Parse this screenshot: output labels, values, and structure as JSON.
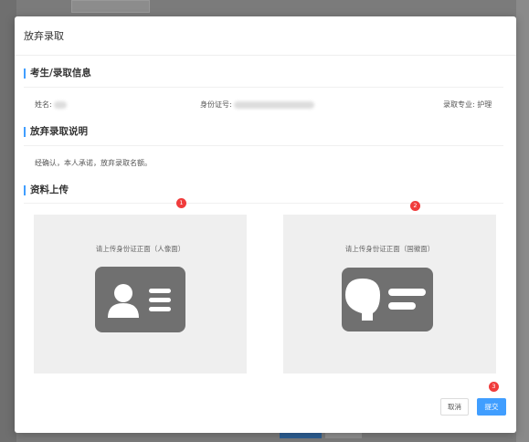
{
  "dialog": {
    "title": "放弃录取"
  },
  "sections": {
    "info_title": "考生/录取信息",
    "desc_title": "放弃录取说明",
    "upload_title": "资料上传"
  },
  "info": {
    "name_label": "姓名:",
    "id_label": "身份证号:",
    "major_label": "录取专业:",
    "major_value": "护理"
  },
  "description": "经确认，本人承诺，放弃录取名额。",
  "uploads": [
    {
      "label": "请上传身份证正面（人像面）",
      "icon": "id-card-portrait-icon"
    },
    {
      "label": "请上传身份证正面（国徽面）",
      "icon": "id-card-emblem-icon"
    }
  ],
  "badges": [
    "1",
    "2",
    "3"
  ],
  "buttons": {
    "cancel": "取消",
    "submit": "提交"
  },
  "colors": {
    "accent": "#409eff",
    "badge": "#f03c3c",
    "icon": "#707070"
  }
}
